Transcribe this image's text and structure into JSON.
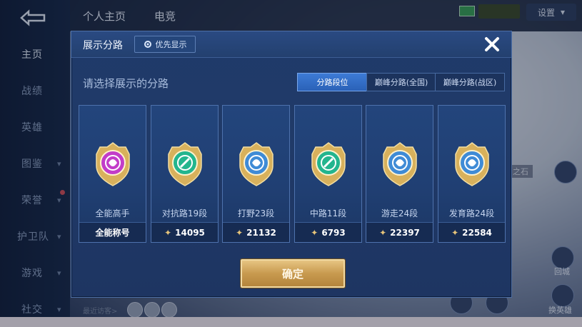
{
  "nav": {
    "items": [
      {
        "label": "主页",
        "active": true,
        "chevron": false
      },
      {
        "label": "战绩",
        "active": false,
        "chevron": false
      },
      {
        "label": "英雄",
        "active": false,
        "chevron": false
      },
      {
        "label": "图鉴",
        "active": false,
        "chevron": true
      },
      {
        "label": "荣誉",
        "active": false,
        "chevron": true
      },
      {
        "label": "护卫队",
        "active": false,
        "chevron": true
      },
      {
        "label": "游戏",
        "active": false,
        "chevron": true
      },
      {
        "label": "社交",
        "active": false,
        "chevron": true
      }
    ]
  },
  "topbar": {
    "tabs": [
      "个人主页",
      "电竞"
    ],
    "settings_label": "设置"
  },
  "background": {
    "recent_visitors_label": "最近访客>",
    "stone_label": "之石",
    "right_button_1": "回城",
    "right_button_2": "换英雄"
  },
  "modal": {
    "title": "展示分路",
    "priority_button": "优先显示",
    "subtitle": "请选择展示的分路",
    "segments": [
      "分路段位",
      "巅峰分路(全国)",
      "巅峰分路(战区)"
    ],
    "active_segment": 0,
    "confirm_label": "确定",
    "cards": [
      {
        "name": "全能高手",
        "footer": "全能称号",
        "score_icon": false,
        "medal": "allround-medal-icon",
        "color": "#c23cc9"
      },
      {
        "name": "对抗路19段",
        "footer": "14095",
        "score_icon": true,
        "medal": "top-lane-medal-icon",
        "color": "#23b58e"
      },
      {
        "name": "打野23段",
        "footer": "21132",
        "score_icon": true,
        "medal": "jungle-medal-icon",
        "color": "#3f8bd6"
      },
      {
        "name": "中路11段",
        "footer": "6793",
        "score_icon": true,
        "medal": "mid-lane-medal-icon",
        "color": "#23b58e"
      },
      {
        "name": "游走24段",
        "footer": "22397",
        "score_icon": true,
        "medal": "roam-medal-icon",
        "color": "#3f8bd6"
      },
      {
        "name": "发育路24段",
        "footer": "22584",
        "score_icon": true,
        "medal": "farm-lane-medal-icon",
        "color": "#3f8bd6"
      }
    ]
  },
  "colors": {
    "modal_bg": "#203a68",
    "accent_blue": "#3d7bd6",
    "confirm_gold": "#c89a4f"
  }
}
